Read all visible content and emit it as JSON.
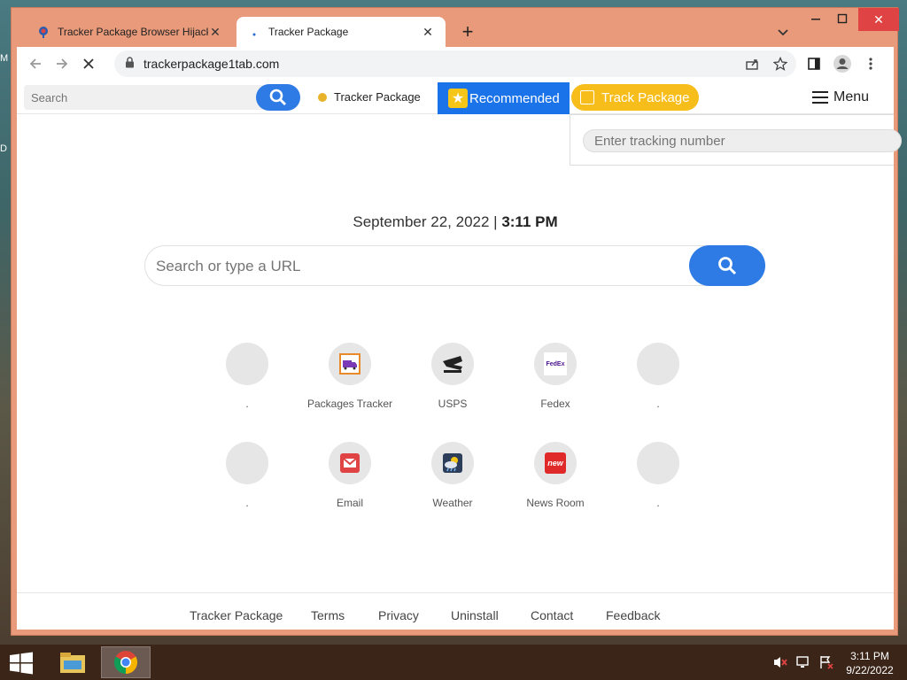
{
  "desktop": {
    "edge_letters": [
      "M",
      "D"
    ]
  },
  "browser": {
    "tabs": [
      {
        "title": "Tracker Package Browser Hijacke",
        "active": false
      },
      {
        "title": "Tracker Package",
        "active": true
      }
    ],
    "new_tab": "+",
    "url": "trackerpackage1tab.com"
  },
  "page": {
    "top_search_placeholder": "Search",
    "brand_link": "Tracker Package",
    "recommended": "Recommended",
    "track_package": "Track Package",
    "menu": "Menu",
    "tracking_placeholder": "Enter tracking number",
    "date": "September 22, 2022 |",
    "time": "3:11 PM",
    "main_search_placeholder": "Search or type a URL",
    "tiles": [
      {
        "label": ".",
        "icon": "empty"
      },
      {
        "label": "Packages Tracker",
        "icon": "truck-icon"
      },
      {
        "label": "USPS",
        "icon": "usps-eagle-icon"
      },
      {
        "label": "Fedex",
        "icon": "fedex-icon",
        "icon_text": "FedEx"
      },
      {
        "label": ".",
        "icon": "empty"
      },
      {
        "label": ".",
        "icon": "empty"
      },
      {
        "label": "Email",
        "icon": "gmail-icon"
      },
      {
        "label": "Weather",
        "icon": "weather-icon"
      },
      {
        "label": "News Room",
        "icon": "news-icon",
        "icon_text": "new"
      },
      {
        "label": ".",
        "icon": "empty"
      }
    ],
    "footer": [
      "Tracker Package",
      "Terms",
      "Privacy",
      "Uninstall",
      "Contact",
      "Feedback"
    ]
  },
  "taskbar": {
    "clock_time": "3:11 PM",
    "clock_date": "9/22/2022"
  },
  "colors": {
    "accent_blue": "#2f7be5",
    "recommended_blue": "#1a73e8",
    "track_yellow": "#f7bd1b",
    "window_frame": "#e89a7a"
  }
}
